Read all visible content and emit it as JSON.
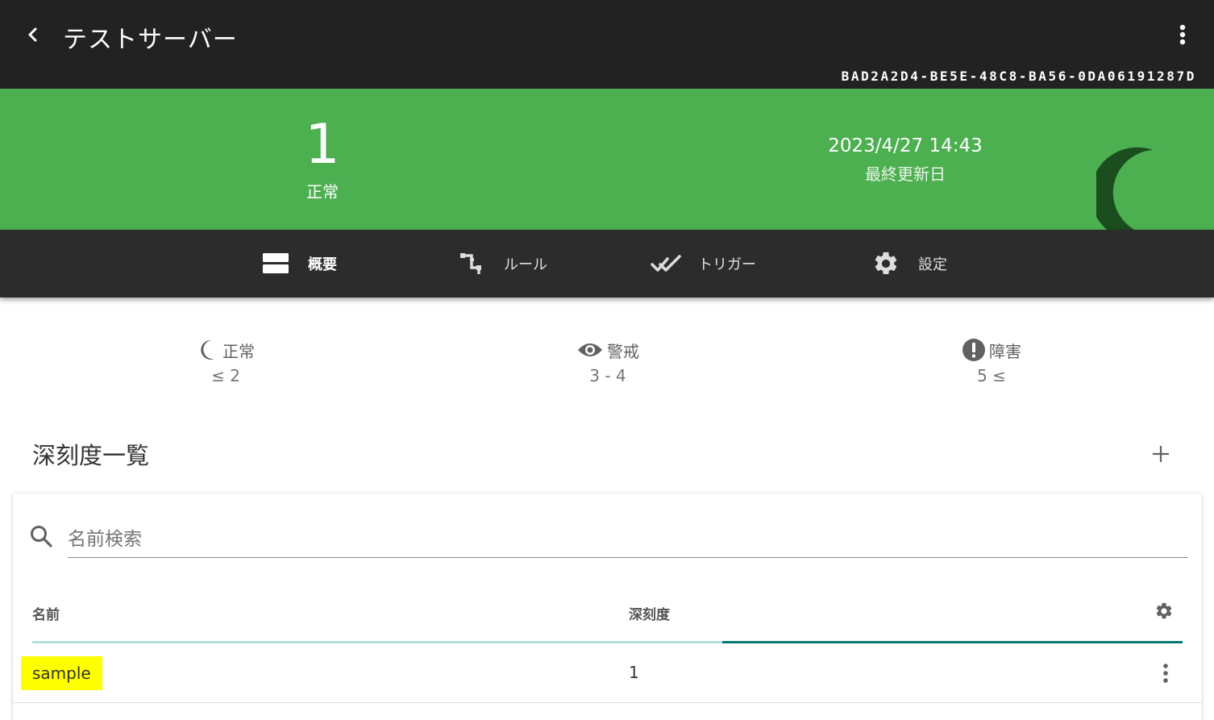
{
  "header": {
    "title": "テストサーバー",
    "server_id": "BAD2A2D4-BE5E-48C8-BA56-0DA06191287D"
  },
  "banner": {
    "count": "1",
    "status": "正常",
    "updated_time": "2023/4/27 14:43",
    "updated_label": "最終更新日",
    "color": "#4caf50"
  },
  "tabs": [
    {
      "label": "概要",
      "icon": "overview-icon",
      "active": true
    },
    {
      "label": "ルール",
      "icon": "rule-icon",
      "active": false
    },
    {
      "label": "トリガー",
      "icon": "trigger-icon",
      "active": false
    },
    {
      "label": "設定",
      "icon": "gear-icon",
      "active": false
    }
  ],
  "thresholds": [
    {
      "label": "正常",
      "range": "≤ 2",
      "icon": "moon-icon"
    },
    {
      "label": "警戒",
      "range": "3 - 4",
      "icon": "eye-icon"
    },
    {
      "label": "障害",
      "range": "5 ≤",
      "icon": "alert-icon"
    }
  ],
  "section": {
    "title": "深刻度一覧"
  },
  "search": {
    "placeholder": "名前検索",
    "value": ""
  },
  "table": {
    "columns": [
      "名前",
      "深刻度"
    ],
    "progress": 0.4,
    "rows": [
      {
        "name": "sample",
        "level": "1"
      }
    ]
  },
  "colors": {
    "topbar": "#222222",
    "tabbar": "#2c2c2c",
    "highlight": "#ffff00",
    "progress_track": "#b2dfdb",
    "progress_fill": "#00796b"
  }
}
